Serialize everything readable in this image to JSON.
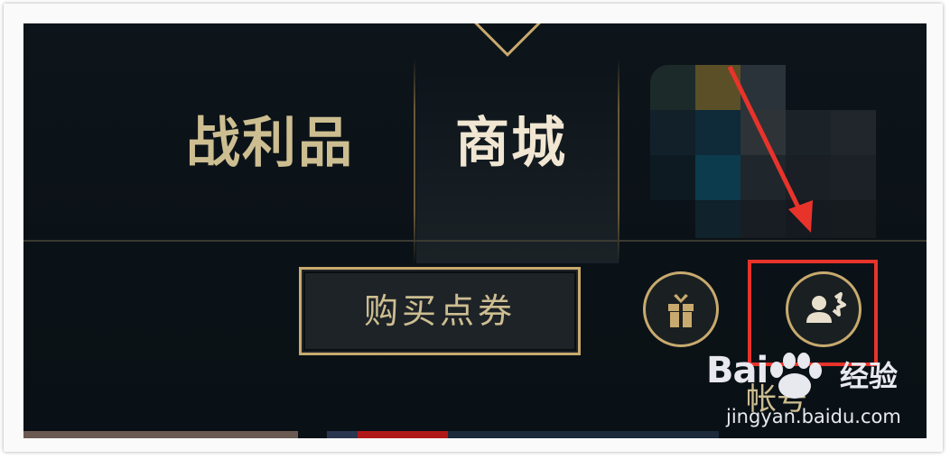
{
  "nav": {
    "tabs": [
      {
        "label": "战利品",
        "active": false
      },
      {
        "label": "商城",
        "active": true
      }
    ]
  },
  "actions": {
    "buy_rp_label": "购买点券",
    "gift_icon": "gift-icon",
    "account_icon": "account-settings-icon",
    "account_label": "帐号"
  },
  "watermark": {
    "logo": "Bai",
    "logo_suffix": "经验",
    "url": "jingyan.baidu.com"
  },
  "colors": {
    "gold": "#c8aa6e",
    "gold_text": "#cdbe91",
    "active_text": "#f0e6d2",
    "background": "#0b1217",
    "annotation_red": "#e8332b"
  }
}
